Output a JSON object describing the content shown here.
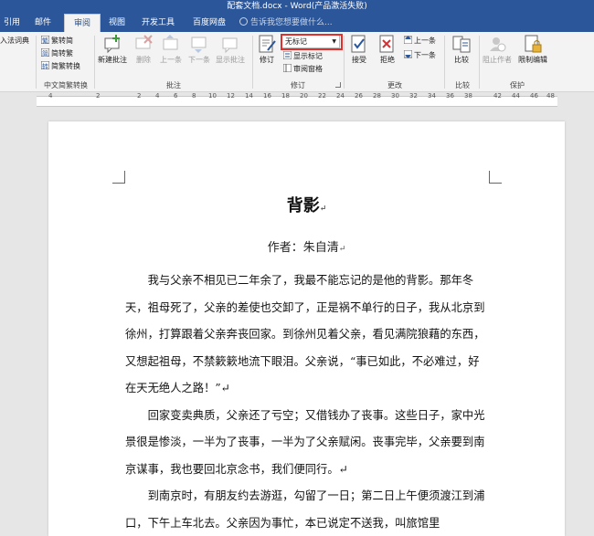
{
  "window": {
    "title": "配套文档.docx - Word(产品激活失败)"
  },
  "tabs": [
    "引用",
    "邮件",
    "审阅",
    "视图",
    "开发工具",
    "百度网盘"
  ],
  "active_tab": "审阅",
  "tell_me": "告诉我您想要做什么...",
  "ribbon": {
    "partial_left": {
      "label": "入法词典"
    },
    "chinese": {
      "items": [
        "繁转简",
        "简转繁",
        "简繁转换"
      ],
      "label": "中文简繁转换"
    },
    "comments": {
      "new_comment": "新建批注",
      "delete": "删除",
      "previous": "上一条",
      "next": "下一条",
      "show_comments": "显示批注",
      "label": "批注"
    },
    "tracking": {
      "track_changes": "修订",
      "markup_dropdown": "无标记",
      "show_markup": "显示标记",
      "reviewing_pane": "审阅窗格",
      "label": "修订"
    },
    "changes": {
      "accept": "接受",
      "reject": "拒绝",
      "previous": "上一条",
      "next": "下一条",
      "label": "更改"
    },
    "compare": {
      "compare": "比较",
      "label": "比较"
    },
    "protect": {
      "block_authors": "阻止作者",
      "restrict_editing": "限制编辑",
      "label": "保护"
    }
  },
  "ruler": {
    "numbers": [
      "4",
      "2",
      "2",
      "4",
      "6",
      "8",
      "10",
      "12",
      "14",
      "16",
      "18",
      "20",
      "22",
      "24",
      "26",
      "28",
      "30",
      "32",
      "34",
      "36",
      "38",
      "42",
      "44",
      "46",
      "48"
    ]
  },
  "document": {
    "title": "背影",
    "author": "作者：朱自清",
    "paragraph_mark": "↵",
    "paragraphs": [
      "我与父亲不相见已二年余了，我最不能忘记的是他的背影。那年冬天，祖母死了，父亲的差使也交卸了，正是祸不单行的日子，我从北京到徐州，打算跟着父亲奔丧回家。到徐州见着父亲，看见满院狼藉的东西，又想起祖母，不禁簌簌地流下眼泪。父亲说，“事已如此，不必难过，好在天无绝人之路！”↵",
      "回家变卖典质，父亲还了亏空；又借钱办了丧事。这些日子，家中光景很是惨淡，一半为了丧事，一半为了父亲赋闲。丧事完毕，父亲要到南京谋事，我也要回北京念书，我们便同行。↵",
      "到南京时，有朋友约去游逛，勾留了一日；第二日上午便须渡江到浦口，下午上车北去。父亲因为事忙，本已说定不送我，叫旅馆里"
    ]
  }
}
